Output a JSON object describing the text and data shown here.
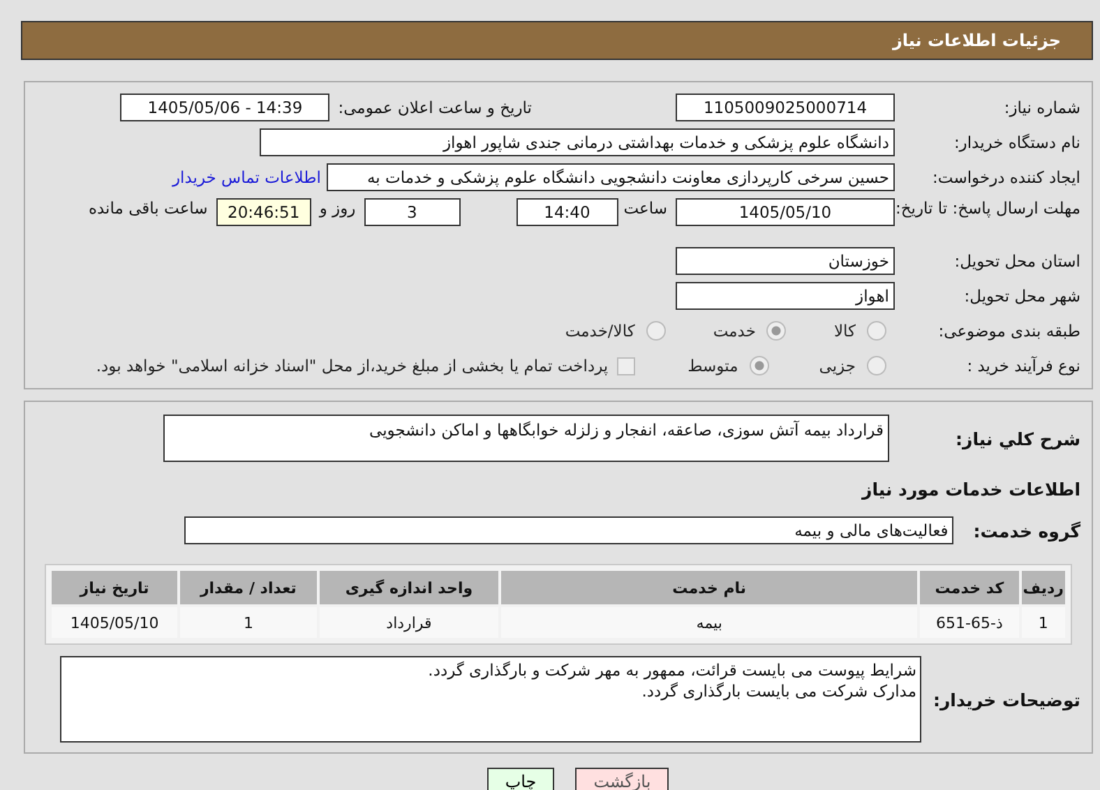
{
  "header": {
    "title": "جزئیات اطلاعات نیاز"
  },
  "need_number": {
    "label": "شماره نیاز:",
    "value": "1105009025000714"
  },
  "announce": {
    "label": "تاریخ و ساعت اعلان عمومی:",
    "value": "1405/05/06 - 14:39"
  },
  "buyer": {
    "label": "نام دستگاه خریدار:",
    "value": "دانشگاه علوم پزشکی و خدمات بهداشتی درمانی جندی شاپور اهواز"
  },
  "requester": {
    "label": "ایجاد کننده درخواست:",
    "value": "حسین سرخی کارپردازی معاونت دانشجویی دانشگاه علوم پزشکی و خدمات به",
    "link": "اطلاعات تماس خریدار"
  },
  "deadline": {
    "label": "مهلت ارسال پاسخ: تا تاریخ:",
    "date": "1405/05/10",
    "time_label": "ساعت",
    "time": "14:40",
    "days": "3",
    "days_label": "روز و",
    "remaining": "20:46:51",
    "remaining_label": "ساعت باقی مانده"
  },
  "province": {
    "label": "استان محل تحویل:",
    "value": "خوزستان"
  },
  "city": {
    "label": "شهر محل تحویل:",
    "value": "اهواز"
  },
  "category": {
    "label": "طبقه بندی موضوعی:",
    "options": [
      {
        "label": "کالا",
        "selected": false
      },
      {
        "label": "خدمت",
        "selected": true
      },
      {
        "label": "کالا/خدمت",
        "selected": false
      }
    ]
  },
  "process": {
    "label": "نوع فرآیند خرید :",
    "options": [
      {
        "label": "جزیی",
        "selected": false
      },
      {
        "label": "متوسط",
        "selected": true
      }
    ],
    "payment": {
      "checked": false,
      "text": "پرداخت تمام یا بخشی از مبلغ خرید،از محل \"اسناد خزانه اسلامی\" خواهد بود."
    }
  },
  "description": {
    "label": "شرح کلي نياز:",
    "value": "قرارداد بیمه آتش سوزی، صاعقه، انفجار و زلزله خوابگاهها و اماکن دانشجویی"
  },
  "services_heading": "اطلاعات خدمات مورد نیاز",
  "service_group": {
    "label": "گروه خدمت:",
    "value": "فعالیت‌های مالی و بیمه"
  },
  "table": {
    "columns": [
      "ردیف",
      "کد خدمت",
      "نام خدمت",
      "واحد اندازه گیری",
      "تعداد / مقدار",
      "تاریخ نیاز"
    ],
    "rows": [
      [
        "1",
        "ذ-65-651",
        "بیمه",
        "قرارداد",
        "1",
        "1405/05/10"
      ]
    ]
  },
  "buyer_notes": {
    "label": "توضیحات خریدار:",
    "lines": [
      "شرایط پیوست می بایست قرائت، ممهور به مهر شرکت و بارگذاری گردد.",
      "مدارک شرکت می بایست بارگذاری گردد."
    ]
  },
  "buttons": [
    {
      "label": "بازگشت",
      "kind": "back"
    },
    {
      "label": "چاپ",
      "kind": "print"
    }
  ]
}
